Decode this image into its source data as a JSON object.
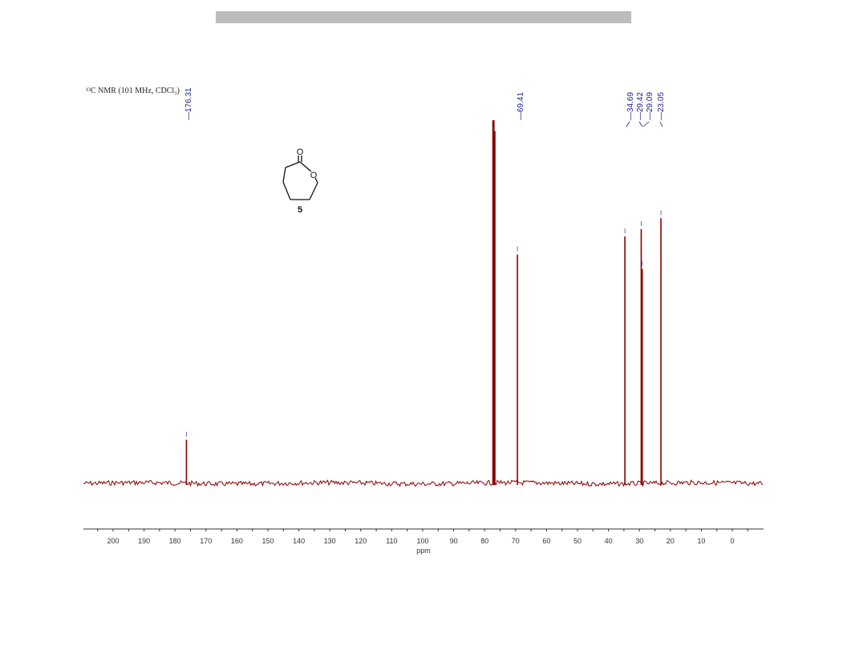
{
  "page": {
    "nmr_title": "¹³C NMR (101 MHz, CDCl₃)",
    "compound_label": "5",
    "molecule_atom_labels": [
      "O",
      "O"
    ]
  },
  "colors": {
    "spectrum": "#8b0000",
    "peak_label": "#1a1a8a",
    "axis": "#333333",
    "header_bar": "#bdbdbd"
  },
  "chart_data": {
    "type": "line",
    "title": "",
    "xlabel": "ppm",
    "ylabel": "",
    "xlim": [
      210,
      -10
    ],
    "x_reversed": true,
    "x_ticks": [
      200,
      190,
      180,
      170,
      160,
      150,
      140,
      130,
      120,
      110,
      100,
      90,
      80,
      70,
      60,
      50,
      40,
      30,
      20,
      10,
      0
    ],
    "peak_labels": [
      "176.31",
      "69.41",
      "34.69",
      "29.42",
      "29.09",
      "23.05"
    ],
    "peaks": [
      {
        "ppm": 176.31,
        "intensity": 0.12,
        "labeled": true
      },
      {
        "ppm": 77.32,
        "intensity": 1.0,
        "labeled": false
      },
      {
        "ppm": 77.0,
        "intensity": 1.0,
        "labeled": false
      },
      {
        "ppm": 76.68,
        "intensity": 0.97,
        "labeled": false
      },
      {
        "ppm": 69.41,
        "intensity": 0.63,
        "labeled": true
      },
      {
        "ppm": 34.69,
        "intensity": 0.68,
        "labeled": true
      },
      {
        "ppm": 29.42,
        "intensity": 0.7,
        "labeled": true
      },
      {
        "ppm": 29.09,
        "intensity": 0.59,
        "labeled": true
      },
      {
        "ppm": 23.05,
        "intensity": 0.73,
        "labeled": true
      }
    ],
    "grid": false,
    "legend": "none"
  }
}
